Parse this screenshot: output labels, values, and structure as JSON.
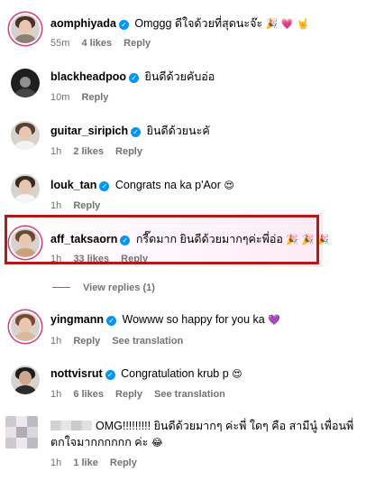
{
  "comments": [
    {
      "username": "aomphiyada",
      "text": "Omggg ดีใจด้วยที่สุดนะจ๊ะ",
      "emoji": [
        "🎉",
        "💗",
        "🤘"
      ],
      "time": "55m",
      "likes": "4 likes",
      "reply": "Reply"
    },
    {
      "username": "blackheadpoo",
      "text": "ยินดีด้วยคับอ่อ",
      "time": "10m",
      "reply": "Reply"
    },
    {
      "username": "guitar_siripich",
      "text": "ยินดีด้วยนะคั",
      "time": "1h",
      "likes": "2 likes",
      "reply": "Reply"
    },
    {
      "username": "louk_tan",
      "text": "Congrats na ka p'Aor",
      "emoji": [
        "😍"
      ],
      "time": "1h",
      "reply": "Reply"
    },
    {
      "username": "aff_taksaorn",
      "text": "กรี๊ดมาก ยินดีด้วยมากๆค่ะพี่อ่อ",
      "emoji": [
        "🎉",
        "🎉",
        "🎉"
      ],
      "time": "1h",
      "likes": "33 likes",
      "reply": "Reply"
    },
    {
      "username": "yingmann",
      "text": "Wowww so happy for you ka",
      "emoji": [
        "💜"
      ],
      "time": "1h",
      "reply": "Reply",
      "translate": "See translation"
    },
    {
      "username": "nottvisrut",
      "text": "Congratulation krub p",
      "emoji": [
        "😍"
      ],
      "time": "1h",
      "likes": "6 likes",
      "reply": "Reply",
      "translate": "See translation"
    },
    {
      "text_line1": "OMG!!!!!!!!! ยินดีด้วยมากๆ ค่ะพี่ ใดๆ คือ สามีนู๋ เพื่อนพี่",
      "text_line2": "ตกใจมากกกกกก ค่ะ",
      "emoji": [
        "😂"
      ],
      "time": "1h",
      "likes": "1 like",
      "reply": "Reply"
    }
  ],
  "view_replies": "View replies (1)",
  "colors": {
    "highlight_border": "#b11a1a",
    "verified": "#0095f6",
    "meta_gray": "#737373",
    "story_ring": "#d83a7c"
  }
}
